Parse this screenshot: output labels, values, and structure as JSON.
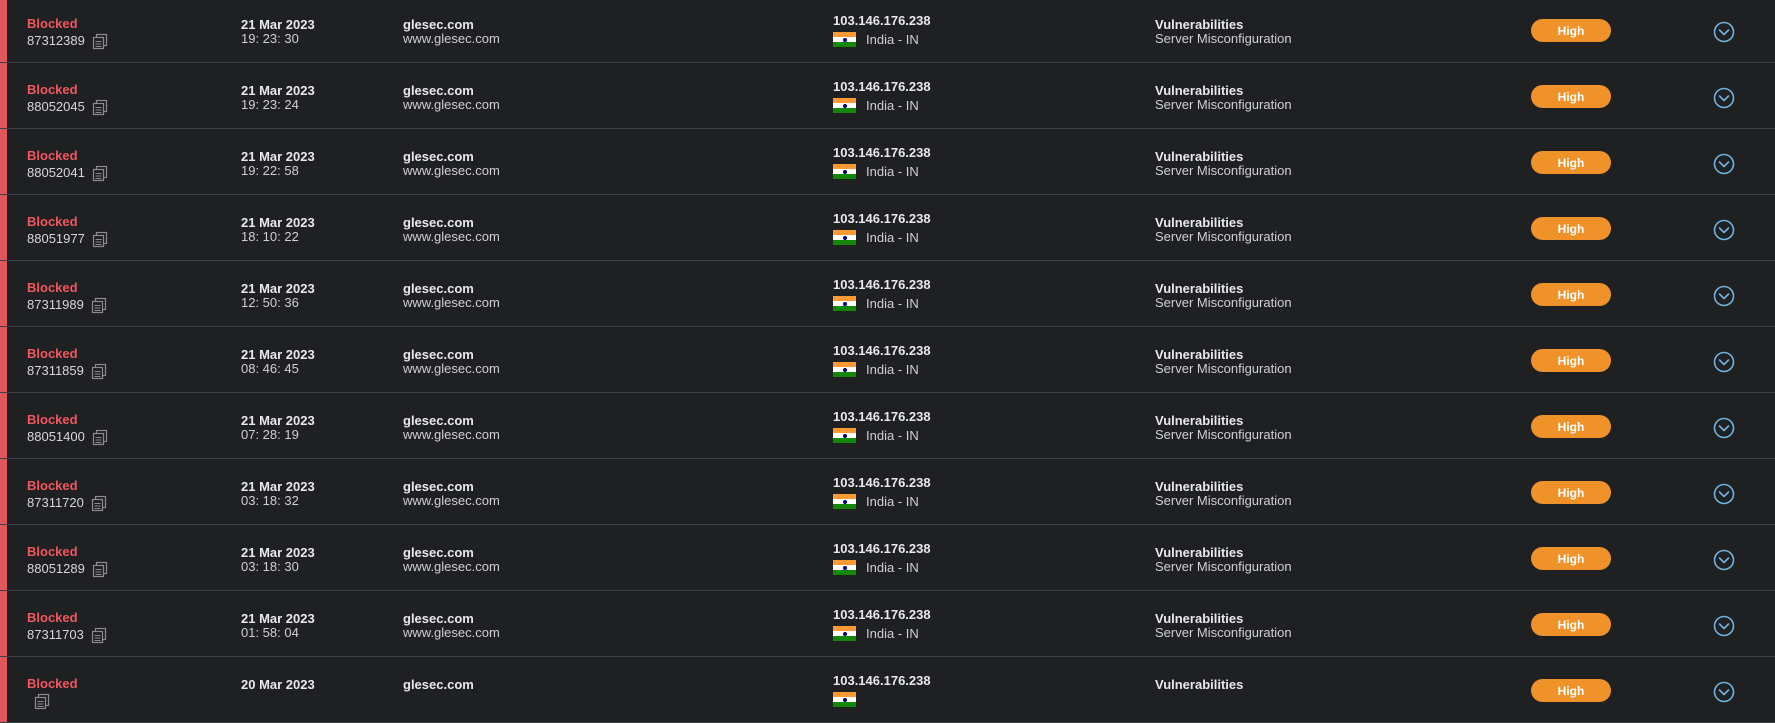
{
  "events": [
    {
      "status": "Blocked",
      "id": "87312389",
      "date": "21 Mar 2023",
      "time": "19: 23: 30",
      "domain": "glesec.com",
      "host": "www.glesec.com",
      "ip": "103.146.176.238",
      "country": "India - IN",
      "category": "Vulnerabilities",
      "subcategory": "Server Misconfiguration",
      "severity": "High"
    },
    {
      "status": "Blocked",
      "id": "88052045",
      "date": "21 Mar 2023",
      "time": "19: 23: 24",
      "domain": "glesec.com",
      "host": "www.glesec.com",
      "ip": "103.146.176.238",
      "country": "India - IN",
      "category": "Vulnerabilities",
      "subcategory": "Server Misconfiguration",
      "severity": "High"
    },
    {
      "status": "Blocked",
      "id": "88052041",
      "date": "21 Mar 2023",
      "time": "19: 22: 58",
      "domain": "glesec.com",
      "host": "www.glesec.com",
      "ip": "103.146.176.238",
      "country": "India - IN",
      "category": "Vulnerabilities",
      "subcategory": "Server Misconfiguration",
      "severity": "High"
    },
    {
      "status": "Blocked",
      "id": "88051977",
      "date": "21 Mar 2023",
      "time": "18: 10: 22",
      "domain": "glesec.com",
      "host": "www.glesec.com",
      "ip": "103.146.176.238",
      "country": "India - IN",
      "category": "Vulnerabilities",
      "subcategory": "Server Misconfiguration",
      "severity": "High"
    },
    {
      "status": "Blocked",
      "id": "87311989",
      "date": "21 Mar 2023",
      "time": "12: 50: 36",
      "domain": "glesec.com",
      "host": "www.glesec.com",
      "ip": "103.146.176.238",
      "country": "India - IN",
      "category": "Vulnerabilities",
      "subcategory": "Server Misconfiguration",
      "severity": "High"
    },
    {
      "status": "Blocked",
      "id": "87311859",
      "date": "21 Mar 2023",
      "time": "08: 46: 45",
      "domain": "glesec.com",
      "host": "www.glesec.com",
      "ip": "103.146.176.238",
      "country": "India - IN",
      "category": "Vulnerabilities",
      "subcategory": "Server Misconfiguration",
      "severity": "High"
    },
    {
      "status": "Blocked",
      "id": "88051400",
      "date": "21 Mar 2023",
      "time": "07: 28: 19",
      "domain": "glesec.com",
      "host": "www.glesec.com",
      "ip": "103.146.176.238",
      "country": "India - IN",
      "category": "Vulnerabilities",
      "subcategory": "Server Misconfiguration",
      "severity": "High"
    },
    {
      "status": "Blocked",
      "id": "87311720",
      "date": "21 Mar 2023",
      "time": "03: 18: 32",
      "domain": "glesec.com",
      "host": "www.glesec.com",
      "ip": "103.146.176.238",
      "country": "India - IN",
      "category": "Vulnerabilities",
      "subcategory": "Server Misconfiguration",
      "severity": "High"
    },
    {
      "status": "Blocked",
      "id": "88051289",
      "date": "21 Mar 2023",
      "time": "03: 18: 30",
      "domain": "glesec.com",
      "host": "www.glesec.com",
      "ip": "103.146.176.238",
      "country": "India - IN",
      "category": "Vulnerabilities",
      "subcategory": "Server Misconfiguration",
      "severity": "High"
    },
    {
      "status": "Blocked",
      "id": "87311703",
      "date": "21 Mar 2023",
      "time": "01: 58: 04",
      "domain": "glesec.com",
      "host": "www.glesec.com",
      "ip": "103.146.176.238",
      "country": "India - IN",
      "category": "Vulnerabilities",
      "subcategory": "Server Misconfiguration",
      "severity": "High"
    },
    {
      "status": "Blocked",
      "id": "",
      "date": "20 Mar 2023",
      "time": "",
      "domain": "glesec.com",
      "host": "",
      "ip": "103.146.176.238",
      "country": "",
      "category": "Vulnerabilities",
      "subcategory": "",
      "severity": "High"
    }
  ],
  "icons": {
    "copy": "copy-icon",
    "flag": "india-flag-icon",
    "expand": "chevron-down-circle-icon"
  },
  "colors": {
    "status_blocked": "#f0575e",
    "row_accent": "#e0565d",
    "severity_high": "#f0922a",
    "expand_icon": "#6fb3e0"
  }
}
